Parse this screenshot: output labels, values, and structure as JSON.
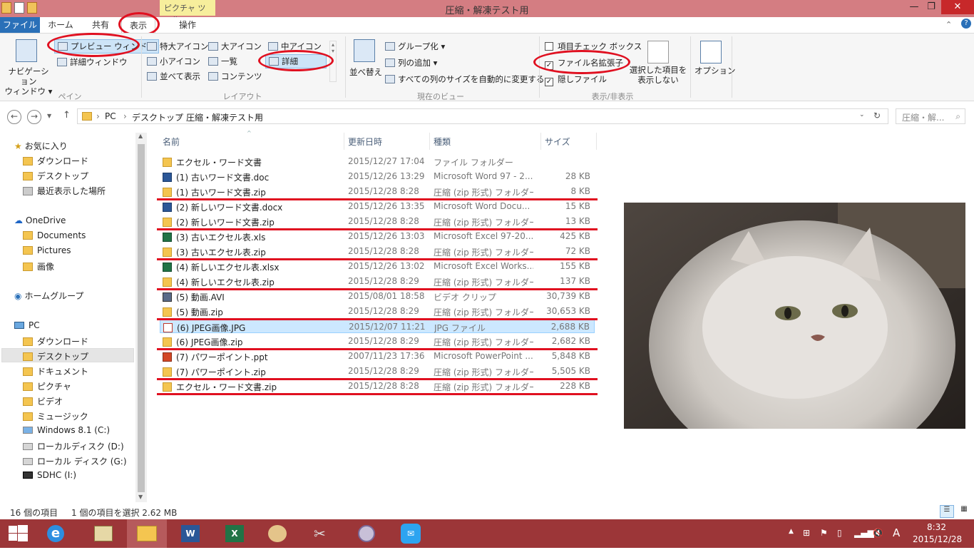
{
  "window": {
    "title": "圧縮・解凍テスト用",
    "contextual_tab": "ピクチャ ツール",
    "min": "—",
    "max": "❐",
    "close": "✕"
  },
  "tabs": {
    "file": "ファイル",
    "home": "ホーム",
    "share": "共有",
    "view": "表示",
    "manage": "操作"
  },
  "ribbon": {
    "pane": {
      "nav_pane": "ナビゲーション\nウィンドウ ▾",
      "preview_pane": "プレビュー ウィンドウ",
      "details_pane": "詳細ウィンドウ",
      "group": "ペイン"
    },
    "layout": {
      "extra_large": "特大アイコン",
      "large": "大アイコン",
      "medium": "中アイコン",
      "small": "小アイコン",
      "list": "一覧",
      "details": "詳細",
      "tiles": "並べて表示",
      "content": "コンテンツ",
      "group": "レイアウト"
    },
    "current_view": {
      "sort": "並べ替え",
      "group_by": "グループ化 ▾",
      "add_columns": "列の追加 ▾",
      "size_all": "すべての列のサイズを自動的に変更する",
      "group": "現在のビュー"
    },
    "show_hide": {
      "item_checkboxes": "項目チェック ボックス",
      "file_extensions": "ファイル名拡張子",
      "hidden_items": "隠しファイル",
      "hide_selected": "選択した項目を\n表示しない",
      "options": "オプション",
      "group": "表示/非表示"
    }
  },
  "address": {
    "crumbs": [
      "PC",
      "デスクトップ",
      "圧縮・解凍テスト用"
    ],
    "search_placeholder": "圧縮・解..."
  },
  "nav": {
    "favorites": "お気に入り",
    "downloads": "ダウンロード",
    "desktop": "デスクトップ",
    "recent": "最近表示した場所",
    "onedrive": "OneDrive",
    "documents": "Documents",
    "pictures": "Pictures",
    "images": "画像",
    "homegroup": "ホームグループ",
    "pc": "PC",
    "pc_downloads": "ダウンロード",
    "pc_desktop": "デスクトップ",
    "pc_documents": "ドキュメント",
    "pc_pictures": "ピクチャ",
    "pc_videos": "ビデオ",
    "pc_music": "ミュージック",
    "drive_c": "Windows 8.1 (C:)",
    "drive_d": "ローカルディスク (D:)",
    "drive_g": "ローカル ディスク (G:)",
    "drive_i": "SDHC (I:)"
  },
  "columns": {
    "name": "名前",
    "date": "更新日時",
    "type": "種類",
    "size": "サイズ"
  },
  "files": [
    {
      "name": "エクセル・ワード文書",
      "date": "2015/12/27 17:04",
      "type": "ファイル フォルダー",
      "size": "",
      "kind": "folder"
    },
    {
      "name": "(1) 古いワード文書.doc",
      "date": "2015/12/26 13:29",
      "type": "Microsoft Word 97 - 2...",
      "size": "28 KB",
      "kind": "word"
    },
    {
      "name": "(1) 古いワード文書.zip",
      "date": "2015/12/28 8:28",
      "type": "圧縮 (zip 形式) フォルダー",
      "size": "8 KB",
      "kind": "zip"
    },
    {
      "name": "(2) 新しいワード文書.docx",
      "date": "2015/12/26 13:35",
      "type": "Microsoft Word Docu...",
      "size": "15 KB",
      "kind": "word"
    },
    {
      "name": "(2) 新しいワード文書.zip",
      "date": "2015/12/28 8:28",
      "type": "圧縮 (zip 形式) フォルダー",
      "size": "13 KB",
      "kind": "zip"
    },
    {
      "name": "(3) 古いエクセル表.xls",
      "date": "2015/12/26 13:03",
      "type": "Microsoft Excel 97-20...",
      "size": "425 KB",
      "kind": "excel"
    },
    {
      "name": "(3) 古いエクセル表.zip",
      "date": "2015/12/28 8:28",
      "type": "圧縮 (zip 形式) フォルダー",
      "size": "72 KB",
      "kind": "zip"
    },
    {
      "name": "(4) 新しいエクセル表.xlsx",
      "date": "2015/12/26 13:02",
      "type": "Microsoft Excel Works...",
      "size": "155 KB",
      "kind": "excel"
    },
    {
      "name": "(4) 新しいエクセル表.zip",
      "date": "2015/12/28 8:29",
      "type": "圧縮 (zip 形式) フォルダー",
      "size": "137 KB",
      "kind": "zip"
    },
    {
      "name": "(5) 動画.AVI",
      "date": "2015/08/01 18:58",
      "type": "ビデオ クリップ",
      "size": "30,739 KB",
      "kind": "video"
    },
    {
      "name": "(5) 動画.zip",
      "date": "2015/12/28 8:29",
      "type": "圧縮 (zip 形式) フォルダー",
      "size": "30,653 KB",
      "kind": "zip"
    },
    {
      "name": "(6)  JPEG画像.JPG",
      "date": "2015/12/07 11:21",
      "type": "JPG ファイル",
      "size": "2,688 KB",
      "kind": "jpg"
    },
    {
      "name": "(6)  JPEG画像.zip",
      "date": "2015/12/28 8:29",
      "type": "圧縮 (zip 形式) フォルダー",
      "size": "2,682 KB",
      "kind": "zip"
    },
    {
      "name": "(7) パワーポイント.ppt",
      "date": "2007/11/23 17:36",
      "type": "Microsoft PowerPoint ...",
      "size": "5,848 KB",
      "kind": "ppt"
    },
    {
      "name": "(7) パワーポイント.zip",
      "date": "2015/12/28 8:29",
      "type": "圧縮 (zip 形式) フォルダー",
      "size": "5,505 KB",
      "kind": "zip"
    },
    {
      "name": "エクセル・ワード文書.zip",
      "date": "2015/12/28 8:28",
      "type": "圧縮 (zip 形式) フォルダー",
      "size": "228 KB",
      "kind": "zip"
    }
  ],
  "status": {
    "count": "16 個の項目",
    "selection": "1 個の項目を選択  2.62 MB"
  },
  "taskbar": {
    "ime": "A",
    "time": "8:32",
    "date": "2015/12/28"
  },
  "colors": {
    "titlebar": "#d47d82",
    "taskbar": "#9c3638",
    "annotation": "#e01020",
    "file_tab": "#2a70b8"
  }
}
